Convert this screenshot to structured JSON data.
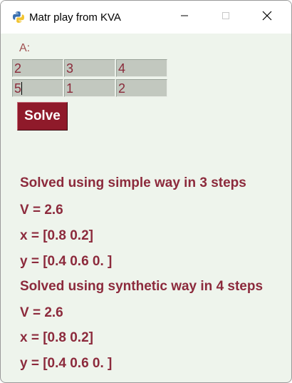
{
  "window": {
    "title": "Matr play from KVA"
  },
  "matrix": {
    "label": "A:",
    "rows": [
      [
        "2",
        "3",
        "4"
      ],
      [
        "5",
        "1",
        "2"
      ]
    ]
  },
  "solve_button": {
    "label": "Solve"
  },
  "results": [
    "Solved using simple way in 3 steps",
    "V = 2.6",
    "x = [0.8 0.2]",
    "y = [0.4 0.6 0. ]",
    "Solved using synthetic way in 4 steps",
    "V = 2.6",
    "x = [0.8 0.2]",
    "y = [0.4 0.6 0. ]"
  ],
  "colors": {
    "text_accent": "#8c2a3c",
    "button_bg": "#8f1a2a",
    "window_bg": "#eef4ec",
    "cell_bg": "#c2c8bf"
  },
  "icons": {
    "app": "python-icon",
    "minimize": "minimize-icon",
    "maximize": "maximize-icon",
    "close": "close-icon"
  }
}
